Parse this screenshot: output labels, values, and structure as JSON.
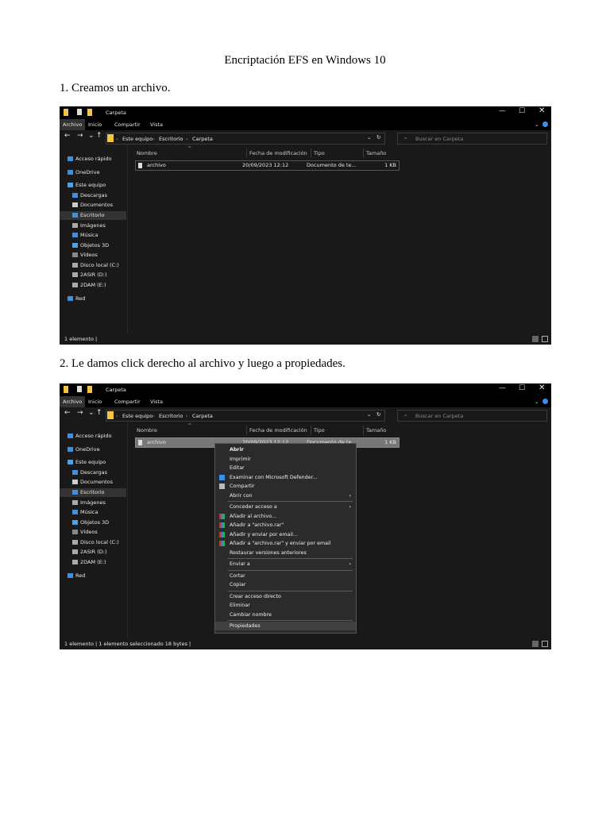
{
  "doc": {
    "title": "Encriptación EFS en Windows 10",
    "step1": "1. Creamos un archivo.",
    "step2": "2. Le damos click derecho al archivo y luego a propiedades."
  },
  "explorer": {
    "window_title": "Carpeta",
    "ribbon_tabs": [
      "Archivo",
      "Inicio",
      "Compartir",
      "Vista"
    ],
    "breadcrumb": [
      "Este equipo",
      "Escritorio",
      "Carpeta"
    ],
    "search_placeholder": "Buscar en Carpeta",
    "sidebar": [
      {
        "label": "Acceso rápido",
        "icon": "star-icon",
        "color": "#3b8eea"
      },
      {
        "label": "OneDrive",
        "icon": "cloud-icon",
        "color": "#3b8eea"
      },
      {
        "label": "Este equipo",
        "icon": "computer-icon",
        "color": "#4aa3e8"
      },
      {
        "label": "Descargas",
        "icon": "download-icon",
        "color": "#3b8eea"
      },
      {
        "label": "Documentos",
        "icon": "document-icon",
        "color": "#cccccc"
      },
      {
        "label": "Escritorio",
        "icon": "desktop-icon",
        "color": "#3b8eea"
      },
      {
        "label": "Imágenes",
        "icon": "image-icon",
        "color": "#aaaaaa"
      },
      {
        "label": "Música",
        "icon": "music-icon",
        "color": "#3b8eea"
      },
      {
        "label": "Objetos 3D",
        "icon": "cube-icon",
        "color": "#4aa3e8"
      },
      {
        "label": "Vídeos",
        "icon": "video-icon",
        "color": "#888888"
      },
      {
        "label": "Disco local (C:)",
        "icon": "drive-icon",
        "color": "#aaaaaa"
      },
      {
        "label": "2ASIR (D:)",
        "icon": "drive-icon",
        "color": "#aaaaaa"
      },
      {
        "label": "2DAM (E:)",
        "icon": "drive-icon",
        "color": "#aaaaaa"
      },
      {
        "label": "Red",
        "icon": "network-icon",
        "color": "#3b8eea"
      }
    ],
    "selected_sidebar": "Escritorio",
    "columns": [
      "Nombre",
      "Fecha de modificación",
      "Tipo",
      "Tamaño"
    ],
    "file": {
      "name": "archivo",
      "date": "20/09/2023 12:12",
      "type": "Documento de te...",
      "size": "1 KB"
    },
    "status1": "1 elemento  |",
    "status2": "1 elemento  |  1 elemento seleccionado  18 bytes  |"
  },
  "context_menu": {
    "items": [
      {
        "label": "Abrir",
        "bold": true
      },
      {
        "label": "Imprimir"
      },
      {
        "label": "Editar"
      },
      {
        "label": "Examinar con Microsoft Defender...",
        "icon": "defender-icon"
      },
      {
        "label": "Compartir",
        "icon": "share-icon"
      },
      {
        "label": "Abrir con",
        "submenu": true
      },
      {
        "sep": true
      },
      {
        "label": "Conceder acceso a",
        "submenu": true
      },
      {
        "label": "Añadir al archivo...",
        "icon": "winrar-icon"
      },
      {
        "label": "Añadir a \"archivo.rar\"",
        "icon": "winrar-icon"
      },
      {
        "label": "Añadir y enviar por email...",
        "icon": "winrar-icon"
      },
      {
        "label": "Añadir a \"archivo.rar\" y enviar por email",
        "icon": "winrar-icon"
      },
      {
        "label": "Restaurar versiones anteriores"
      },
      {
        "sep": true
      },
      {
        "label": "Enviar a",
        "submenu": true
      },
      {
        "sep": true
      },
      {
        "label": "Cortar"
      },
      {
        "label": "Copiar"
      },
      {
        "sep": true
      },
      {
        "label": "Crear acceso directo"
      },
      {
        "label": "Eliminar"
      },
      {
        "label": "Cambiar nombre"
      },
      {
        "sep": true
      },
      {
        "label": "Propiedades",
        "highlighted": true
      }
    ]
  },
  "colors": {
    "window_bg": "#191919",
    "titlebar": "#000000",
    "folder": "#f4c542",
    "accent": "#3b8eea"
  }
}
